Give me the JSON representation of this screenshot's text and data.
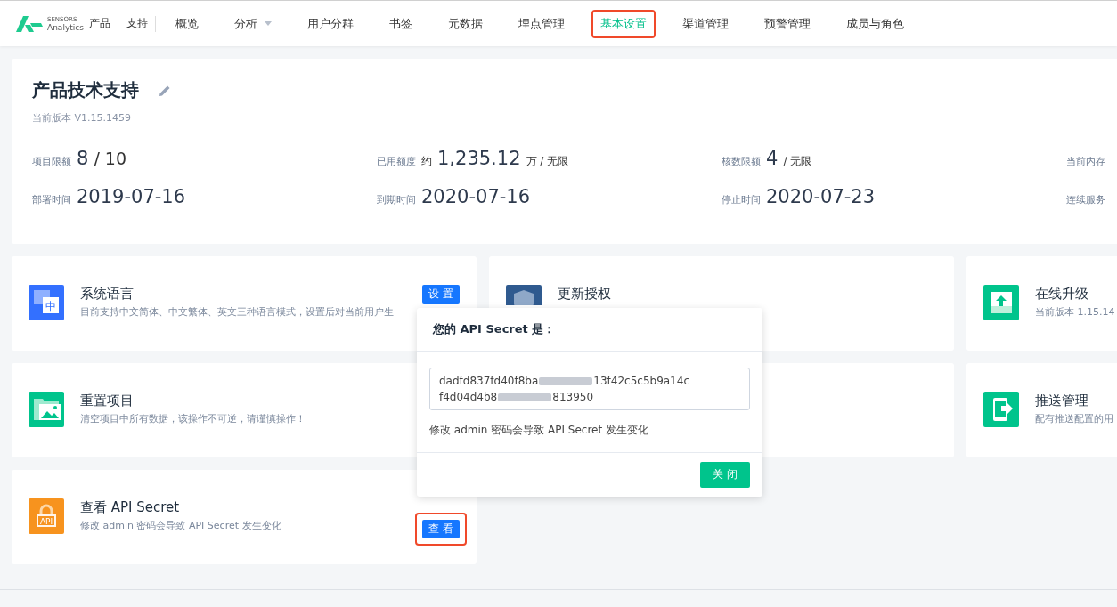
{
  "brand": {
    "line1": "SENSORS",
    "line2": "Analytics"
  },
  "project_switch": {
    "parts": [
      "产品",
      "支持"
    ]
  },
  "nav": [
    {
      "label": "概览",
      "selected": false,
      "dropdown": false,
      "highlighted": false
    },
    {
      "label": "分析",
      "selected": false,
      "dropdown": true,
      "highlighted": false
    },
    {
      "label": "用户分群",
      "selected": false,
      "dropdown": false,
      "highlighted": false
    },
    {
      "label": "书签",
      "selected": false,
      "dropdown": false,
      "highlighted": false
    },
    {
      "label": "元数据",
      "selected": false,
      "dropdown": false,
      "highlighted": false
    },
    {
      "label": "埋点管理",
      "selected": false,
      "dropdown": false,
      "highlighted": false
    },
    {
      "label": "基本设置",
      "selected": true,
      "dropdown": false,
      "highlighted": true
    },
    {
      "label": "渠道管理",
      "selected": false,
      "dropdown": false,
      "highlighted": false
    },
    {
      "label": "预警管理",
      "selected": false,
      "dropdown": false,
      "highlighted": false
    },
    {
      "label": "成员与角色",
      "selected": false,
      "dropdown": false,
      "highlighted": false
    }
  ],
  "project": {
    "title": "产品技术支持",
    "version": "当前版本 V1.15.1459",
    "stats": [
      [
        {
          "label": "项目限额",
          "value": "8",
          "suffix": "/ 10",
          "suffix_big": true
        },
        {
          "label": "已用额度",
          "prefix": "约",
          "value": "1,235.12",
          "suffix": "万 / 无限",
          "suffix_big": false
        },
        {
          "label": "核数限额",
          "value": "4",
          "suffix": "/ 无限",
          "suffix_big": false
        },
        {
          "label": "当前内存"
        }
      ],
      [
        {
          "label": "部署时间",
          "value": "2019-07-16"
        },
        {
          "label": "到期时间",
          "value": "2020-07-16"
        },
        {
          "label": "停止时间",
          "value": "2020-07-23"
        },
        {
          "label": "连续服务"
        }
      ]
    ]
  },
  "cards": [
    [
      {
        "kind": "language",
        "icon_label": "中",
        "title": "系统语言",
        "desc": "目前支持中文简体、中文繁体、英文三种语言模式，设置后对当前用户生",
        "button": "设 置",
        "highlighted": false
      },
      {
        "kind": "license",
        "title": "更新授权"
      },
      {
        "kind": "upgrade",
        "title": "在线升级",
        "desc": "当前版本 1.15.14"
      }
    ],
    [
      {
        "kind": "reset",
        "title": "重置项目",
        "desc": "清空项目中所有数据，该操作不可逆，请谨慎操作！"
      },
      {
        "kind": "blank"
      },
      {
        "kind": "push",
        "title": "推送管理",
        "desc": "配有推送配置的用"
      }
    ],
    [
      {
        "kind": "api",
        "icon_label": "API",
        "title": "查看 API Secret",
        "desc": "修改 admin 密码会导致 API Secret 发生变化",
        "button": "查 看",
        "highlighted": true
      }
    ]
  ],
  "popover": {
    "title": "您的 API Secret 是：",
    "secret_lines": [
      [
        "dadfd837fd40f8ba",
        "13f42c5c5b9a14c"
      ],
      [
        "f4d04d4b8",
        "813950"
      ]
    ],
    "note": "修改 admin 密码会导致 API Secret 发生变化",
    "button": "关 闭"
  }
}
